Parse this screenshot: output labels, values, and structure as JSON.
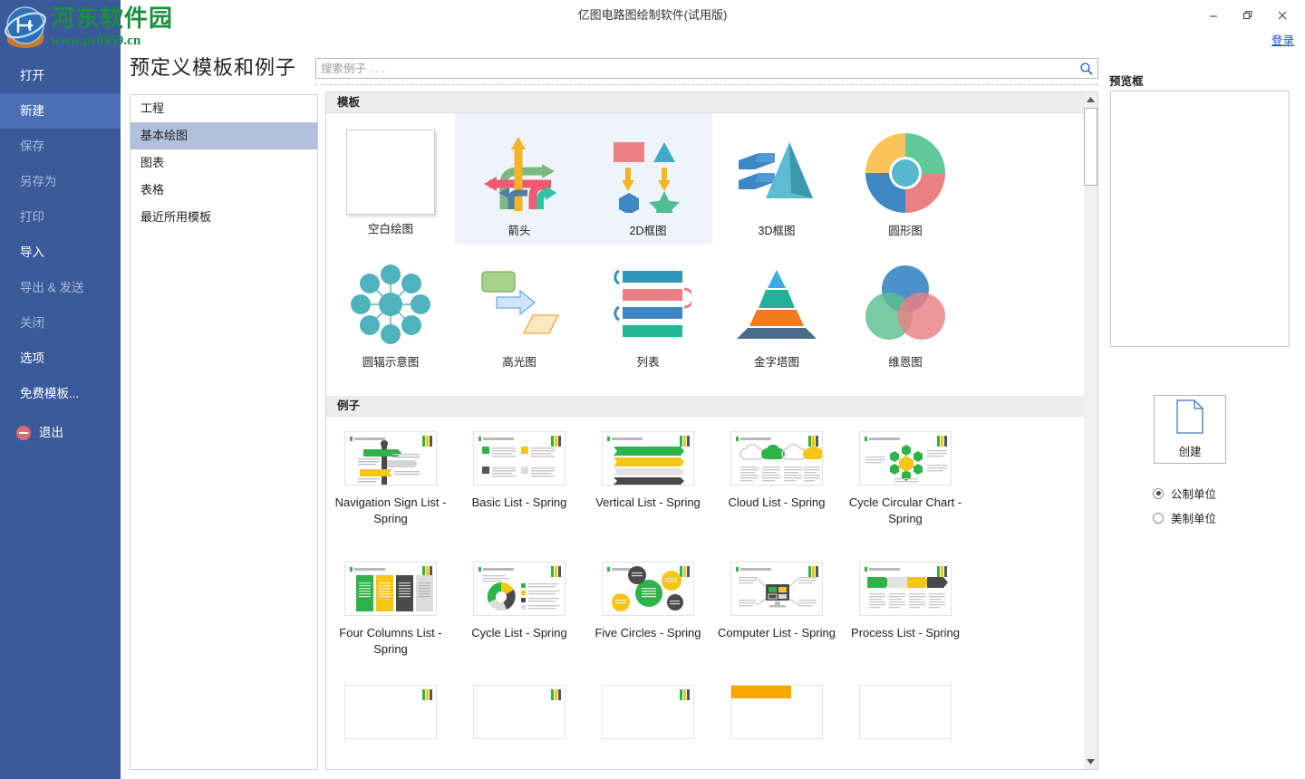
{
  "window": {
    "title": "亿图电路图绘制软件(试用版)",
    "minimize_label": "minimize",
    "restore_label": "restore",
    "close_label": "close",
    "login_label": "登录"
  },
  "watermark": {
    "line1": "河东软件园",
    "line2": "www.pc0359.cn",
    "color": "#1a8f3c"
  },
  "sidebar": {
    "accent": "#3a5a9a",
    "active_bg": "#4a6fb5",
    "items": [
      {
        "label": "打开",
        "state": "normal",
        "icon": ""
      },
      {
        "label": "新建",
        "state": "active",
        "icon": ""
      },
      {
        "label": "保存",
        "state": "disabled",
        "icon": ""
      },
      {
        "label": "另存为",
        "state": "disabled",
        "icon": ""
      },
      {
        "label": "打印",
        "state": "disabled",
        "icon": ""
      },
      {
        "label": "导入",
        "state": "normal",
        "icon": ""
      },
      {
        "label": "导出 & 发送",
        "state": "disabled",
        "icon": ""
      },
      {
        "label": "关闭",
        "state": "disabled",
        "icon": ""
      },
      {
        "label": "选项",
        "state": "normal",
        "icon": ""
      },
      {
        "label": "免费模板...",
        "state": "normal",
        "icon": ""
      },
      {
        "label": "退出",
        "state": "normal",
        "icon": "quit-icon"
      }
    ]
  },
  "page": {
    "title": "预定义模板和例子"
  },
  "categories": {
    "items": [
      {
        "label": "工程",
        "selected": false
      },
      {
        "label": "基本绘图",
        "selected": true
      },
      {
        "label": "图表",
        "selected": false
      },
      {
        "label": "表格",
        "selected": false
      },
      {
        "label": "最近所用模板",
        "selected": false
      }
    ],
    "selected_bg": "#b3c0dd"
  },
  "search": {
    "placeholder": "搜索例子 . . .",
    "value": "",
    "icon": "search-icon"
  },
  "templates_section": {
    "heading": "模板",
    "items": [
      {
        "label": "空白绘图",
        "thumb": "blank-page",
        "highlighted": false
      },
      {
        "label": "箭头",
        "thumb": "arrows",
        "highlighted": true
      },
      {
        "label": "2D框图",
        "thumb": "2d-block",
        "highlighted": true
      },
      {
        "label": "3D框图",
        "thumb": "3d-block",
        "highlighted": false
      },
      {
        "label": "圆形图",
        "thumb": "circular-chart",
        "highlighted": false
      },
      {
        "label": "圆辐示意图",
        "thumb": "radial-diagram",
        "highlighted": false
      },
      {
        "label": "高光图",
        "thumb": "highlight-chart",
        "highlighted": false
      },
      {
        "label": "列表",
        "thumb": "list-chart",
        "highlighted": false
      },
      {
        "label": "金字塔图",
        "thumb": "pyramid-chart",
        "highlighted": false
      },
      {
        "label": "维恩图",
        "thumb": "venn-diagram",
        "highlighted": false
      }
    ]
  },
  "examples_section": {
    "heading": "例子",
    "items": [
      {
        "label": "Navigation Sign List - Spring",
        "thumb": "navigation-sign-list"
      },
      {
        "label": "Basic List - Spring",
        "thumb": "basic-list"
      },
      {
        "label": "Vertical List - Spring",
        "thumb": "vertical-list"
      },
      {
        "label": "Cloud List - Spring",
        "thumb": "cloud-list"
      },
      {
        "label": "Cycle Circular Chart - Spring",
        "thumb": "cycle-circular-chart"
      },
      {
        "label": "Four Columns List - Spring",
        "thumb": "four-columns-list"
      },
      {
        "label": "Cycle List - Spring",
        "thumb": "cycle-list"
      },
      {
        "label": "Five Circles - Spring",
        "thumb": "five-circles"
      },
      {
        "label": "Computer List - Spring",
        "thumb": "computer-list"
      },
      {
        "label": "Process List - Spring",
        "thumb": "process-list"
      }
    ]
  },
  "preview": {
    "title": "预览框",
    "create_label": "创建",
    "create_icon": "document-icon",
    "units": [
      {
        "label": "公制单位",
        "selected": true
      },
      {
        "label": "美制单位",
        "selected": false
      }
    ]
  },
  "scrollbar": {
    "up_icon": "triangle-up-icon",
    "down_icon": "triangle-down-icon",
    "thumb_position": "top"
  }
}
